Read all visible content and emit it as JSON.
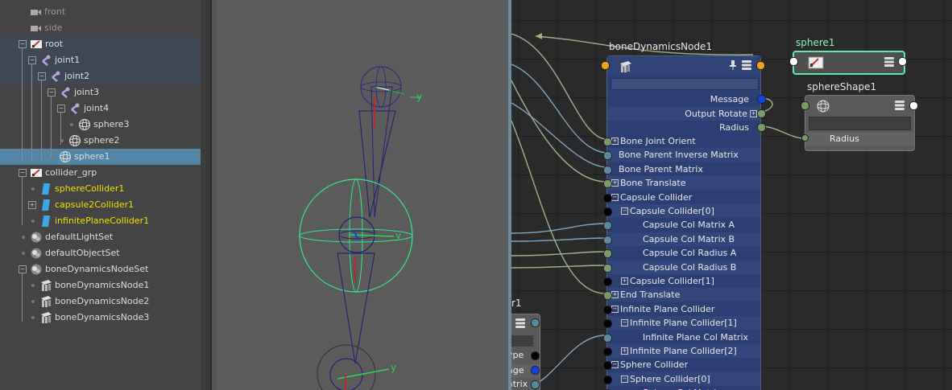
{
  "outliner": {
    "items": [
      {
        "label": "front",
        "style": "dim"
      },
      {
        "label": "side",
        "style": "dim"
      },
      {
        "label": "root",
        "style": ""
      },
      {
        "label": "joint1",
        "style": ""
      },
      {
        "label": "joint2",
        "style": ""
      },
      {
        "label": "joint3",
        "style": ""
      },
      {
        "label": "joint4",
        "style": ""
      },
      {
        "label": "sphere3",
        "style": ""
      },
      {
        "label": "sphere2",
        "style": ""
      },
      {
        "label": "sphere1",
        "style": ""
      },
      {
        "label": "collider_grp",
        "style": ""
      },
      {
        "label": "sphereCollider1",
        "style": "yel"
      },
      {
        "label": "capsule2Collider1",
        "style": "yel"
      },
      {
        "label": "infinitePlaneCollider1",
        "style": "yel"
      },
      {
        "label": "defaultLightSet",
        "style": ""
      },
      {
        "label": "defaultObjectSet",
        "style": ""
      },
      {
        "label": "boneDynamicsNodeSet",
        "style": ""
      },
      {
        "label": "boneDynamicsNode1",
        "style": ""
      },
      {
        "label": "boneDynamicsNode2",
        "style": ""
      },
      {
        "label": "boneDynamicsNode3",
        "style": ""
      }
    ]
  },
  "viewport": {
    "axis_y1": "y",
    "axis_y2": "y",
    "axis_y3": "y"
  },
  "node_editor": {
    "bone_node": {
      "title": "boneDynamicsNode1",
      "outputs": [
        "Message",
        "Output Rotate",
        "Radius"
      ],
      "inputs": [
        {
          "label": "Bone Joint Orient",
          "indent": 0,
          "box": "+"
        },
        {
          "label": "Bone Parent Inverse Matrix",
          "indent": 0,
          "box": ""
        },
        {
          "label": "Bone Parent Matrix",
          "indent": 0,
          "box": ""
        },
        {
          "label": "Bone Translate",
          "indent": 0,
          "box": "+"
        },
        {
          "label": "Capsule Collider",
          "indent": 0,
          "box": "−"
        },
        {
          "label": "Capsule Collider[0]",
          "indent": 1,
          "box": "−"
        },
        {
          "label": "Capsule Col Matrix A",
          "indent": 2,
          "box": ""
        },
        {
          "label": "Capsule Col Matrix B",
          "indent": 2,
          "box": ""
        },
        {
          "label": "Capsule Col Radius A",
          "indent": 2,
          "box": ""
        },
        {
          "label": "Capsule Col Radius B",
          "indent": 2,
          "box": ""
        },
        {
          "label": "Capsule Collider[1]",
          "indent": 1,
          "box": "+"
        },
        {
          "label": "End Translate",
          "indent": 0,
          "box": "+"
        },
        {
          "label": "Infinite Plane Collider",
          "indent": 0,
          "box": "−"
        },
        {
          "label": "Infinite Plane Collider[1]",
          "indent": 1,
          "box": "−"
        },
        {
          "label": "Infinite Plane Col Matrix",
          "indent": 2,
          "box": ""
        },
        {
          "label": "Infinite Plane Collider[2]",
          "indent": 1,
          "box": "+"
        },
        {
          "label": "Sphere Collider",
          "indent": 0,
          "box": "−"
        },
        {
          "label": "Sphere Collider[0]",
          "indent": 1,
          "box": "−"
        },
        {
          "label": "Sphere Col Matrix",
          "indent": 2,
          "box": ""
        }
      ]
    },
    "sphere_node": {
      "title": "sphere1"
    },
    "sphere_shape_node": {
      "title": "sphereShape1",
      "attr": "Radius"
    },
    "partial_node": {
      "title": "r1",
      "attrs": [
        "ype",
        "age",
        "atrix"
      ]
    }
  },
  "colors": {
    "accent": "#5285a6",
    "node_blue": "#2c3f73",
    "selected_node_border": "#5fe8a6",
    "connection": "#9ab58a",
    "connection_blue": "#7fa6c0",
    "collider_text": "#f0e000"
  }
}
